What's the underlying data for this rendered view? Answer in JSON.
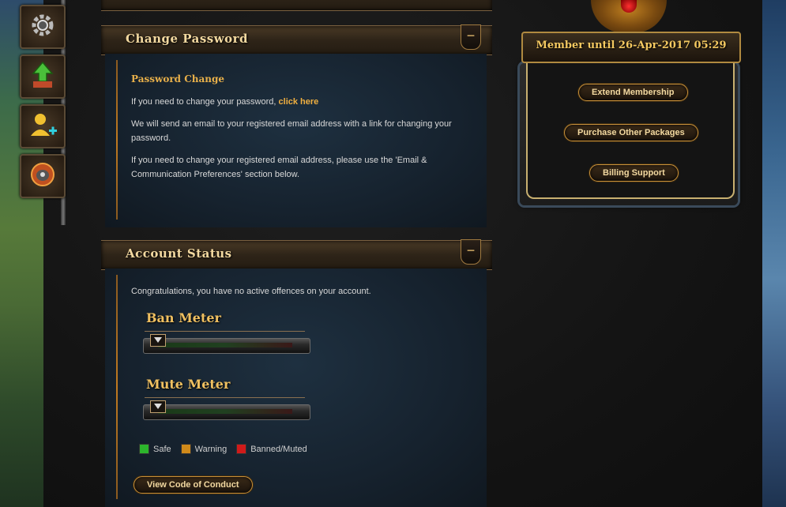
{
  "toolbar": {
    "items": [
      {
        "name": "settings",
        "icon": "gear-icon"
      },
      {
        "name": "upgrade",
        "icon": "upgrade-arrow-icon"
      },
      {
        "name": "add-friend",
        "icon": "add-user-icon"
      },
      {
        "name": "game",
        "icon": "game-icon"
      }
    ]
  },
  "change_password": {
    "header": "Change Password",
    "collapse_symbol": "−",
    "subtitle": "Password Change",
    "line1_text": "If you need to change your password,",
    "line1_link": "click here",
    "line2": "We will send an email to your registered email address with a link for changing your password.",
    "line3": "If you need to change your registered email address, please use the 'Email & Communication Preferences' section below."
  },
  "account_status": {
    "header": "Account Status",
    "collapse_symbol": "−",
    "message": "Congratulations, you have no active offences on your account.",
    "ban_meter": {
      "title": "Ban Meter",
      "level": 0
    },
    "mute_meter": {
      "title": "Mute Meter",
      "level": 0
    },
    "legend": [
      {
        "label": "Safe",
        "color": "#2cb52c"
      },
      {
        "label": "Warning",
        "color": "#d08a1a"
      },
      {
        "label": "Banned/Muted",
        "color": "#d01a1a"
      }
    ],
    "conduct_button": "View Code of Conduct"
  },
  "membership": {
    "banner": "Member until 26-Apr-2017 05:29",
    "buttons": {
      "extend": "Extend Membership",
      "packages": "Purchase Other Packages",
      "billing": "Billing Support"
    }
  },
  "colors": {
    "accent_gold": "#f0b040",
    "header_text": "#f3d9a0",
    "panel_blue": "#1e3040"
  }
}
